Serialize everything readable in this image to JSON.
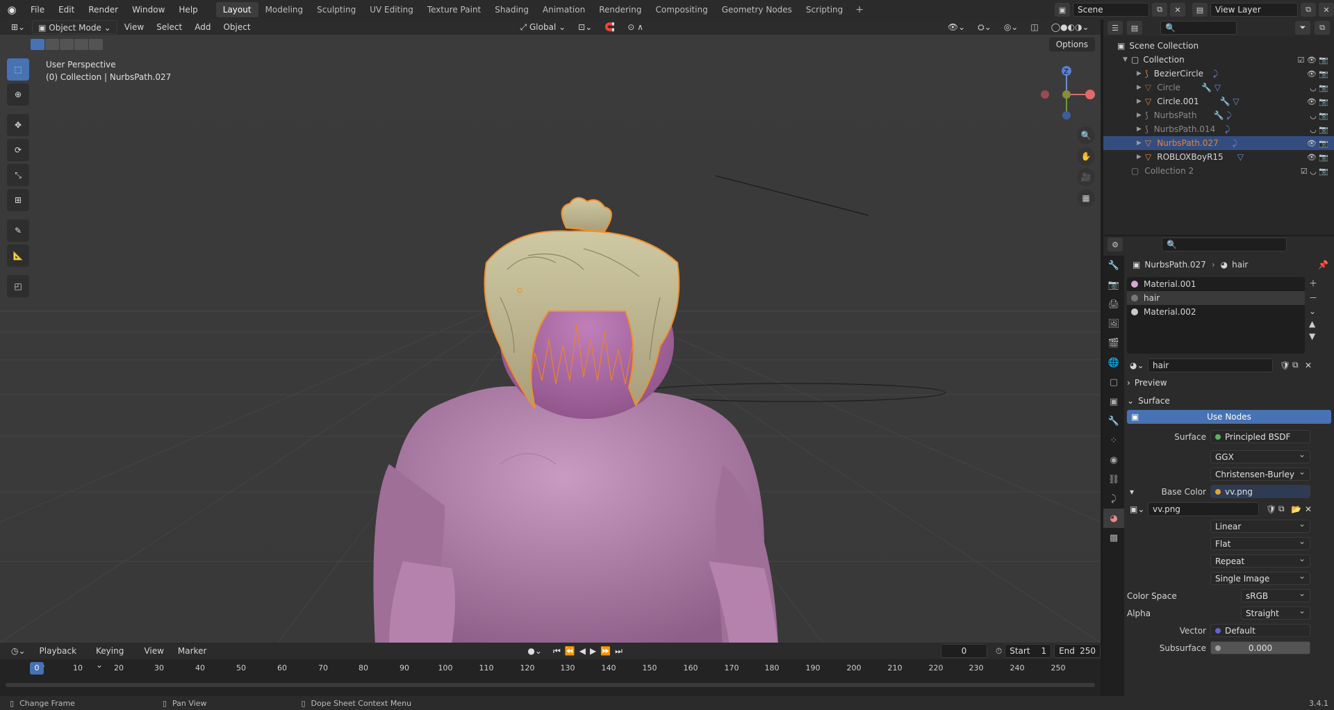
{
  "app": {
    "name": "Blender",
    "version": "3.4.1"
  },
  "menu": [
    "File",
    "Edit",
    "Render",
    "Window",
    "Help"
  ],
  "workspaces": [
    "Layout",
    "Modeling",
    "Sculpting",
    "UV Editing",
    "Texture Paint",
    "Shading",
    "Animation",
    "Rendering",
    "Compositing",
    "Geometry Nodes",
    "Scripting"
  ],
  "active_workspace": "Layout",
  "scene": {
    "name": "Scene",
    "view_layer": "View Layer"
  },
  "viewport": {
    "mode": "Object Mode",
    "menus": [
      "View",
      "Select",
      "Add",
      "Object"
    ],
    "orientation": "Global",
    "options_label": "Options",
    "perspective_label": "User Perspective",
    "context_label": "(0) Collection | NurbsPath.027",
    "gizmo_axis_z": "Z"
  },
  "outliner": {
    "scene_collection": "Scene Collection",
    "collection": "Collection",
    "objects": [
      "BezierCircle",
      "Circle",
      "Circle.001",
      "NurbsPath",
      "NurbsPath.014",
      "NurbsPath.027",
      "ROBLOXBoyR15"
    ],
    "collection2": "Collection 2",
    "selected": "NurbsPath.027"
  },
  "properties": {
    "breadcrumb_object": "NurbsPath.027",
    "breadcrumb_material": "hair",
    "slots": [
      "Material.001",
      "hair",
      "Material.002"
    ],
    "material_name": "hair",
    "preview_label": "Preview",
    "surface_label": "Surface",
    "use_nodes": "Use Nodes",
    "rows": {
      "surface": {
        "label": "Surface",
        "value": "Principled BSDF"
      },
      "distribution": "GGX",
      "subsurface_method": "Christensen-Burley",
      "base_color": {
        "label": "Base Color",
        "value": "vv.png"
      },
      "image": "vv.png",
      "interpolation": "Linear",
      "projection": "Flat",
      "extension": "Repeat",
      "source": "Single Image",
      "color_space": {
        "label": "Color Space",
        "value": "sRGB"
      },
      "alpha": {
        "label": "Alpha",
        "value": "Straight"
      },
      "vector": {
        "label": "Vector",
        "value": "Default"
      },
      "subsurface": {
        "label": "Subsurface",
        "value": "0.000"
      }
    }
  },
  "timeline": {
    "menus": [
      "Playback",
      "Keying",
      "View",
      "Marker"
    ],
    "current_frame": "0",
    "start_label": "Start",
    "start": "1",
    "end_label": "End",
    "end": "250",
    "ticks": [
      "0",
      "10",
      "20",
      "30",
      "40",
      "50",
      "60",
      "70",
      "80",
      "90",
      "100",
      "110",
      "120",
      "130",
      "140",
      "150",
      "160",
      "170",
      "180",
      "190",
      "200",
      "210",
      "220",
      "230",
      "240",
      "250"
    ]
  },
  "status": {
    "left": "Change Frame",
    "middle": "Pan View",
    "right": "Dope Sheet Context Menu",
    "version": "3.4.1"
  }
}
